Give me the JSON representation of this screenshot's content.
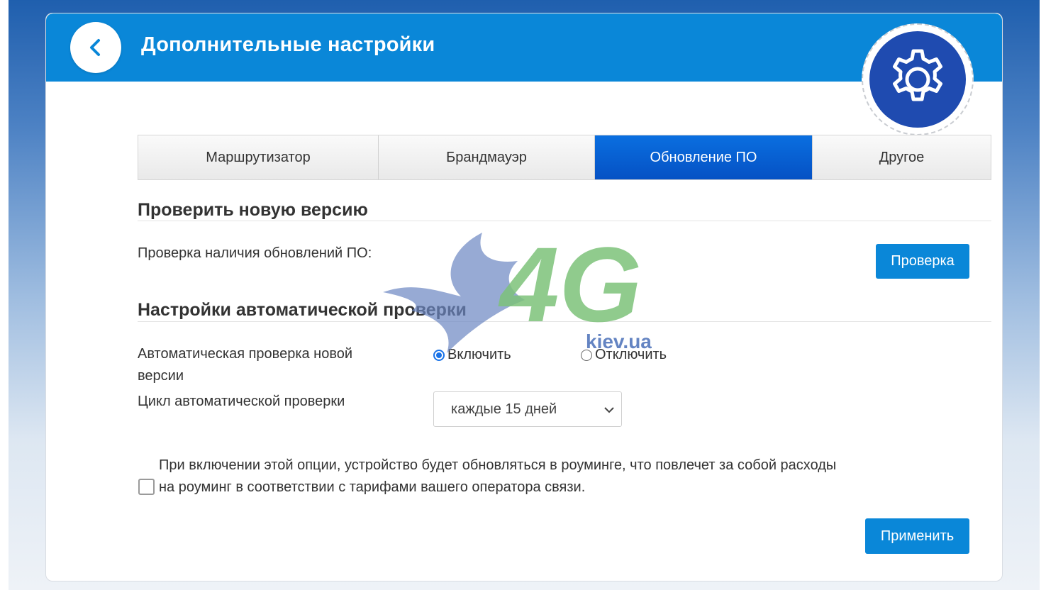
{
  "header": {
    "title": "Дополнительные настройки",
    "back_icon": "chevron-left-icon",
    "settings_icon": "gear-icon"
  },
  "tabs": [
    {
      "label": "Маршрутизатор",
      "active": false
    },
    {
      "label": "Брандмауэр",
      "active": false
    },
    {
      "label": "Обновление ПО",
      "active": true
    },
    {
      "label": "Другое",
      "active": false
    }
  ],
  "check_section": {
    "title": "Проверить новую версию",
    "label": "Проверка наличия обновлений ПО:",
    "button_label": "Проверка"
  },
  "auto_section": {
    "title": "Настройки автоматической проверки",
    "auto_check_label_line1": "Автоматическая проверка новой",
    "auto_check_label_line2": "версии",
    "radio_on_label": "Включить",
    "radio_off_label": "Отключить",
    "selected_radio": "on",
    "cycle_label": "Цикл автоматической проверки",
    "cycle_value": "каждые 15 дней"
  },
  "roaming": {
    "checked": false,
    "text_line1": "При включении этой опции, устройство будет обновляться в роуминге, что повлечет за собой расходы",
    "text_line2": "на роуминг в соответствии с тарифами вашего оператора связи."
  },
  "apply_label": "Применить",
  "watermark": {
    "text": "4G",
    "subtext": "kiev.ua"
  },
  "colors": {
    "header_blue": "#0a87d8",
    "tab_active": "#0551c4",
    "button_blue": "#0a87d8",
    "gear_blue": "#1f4bb0"
  }
}
